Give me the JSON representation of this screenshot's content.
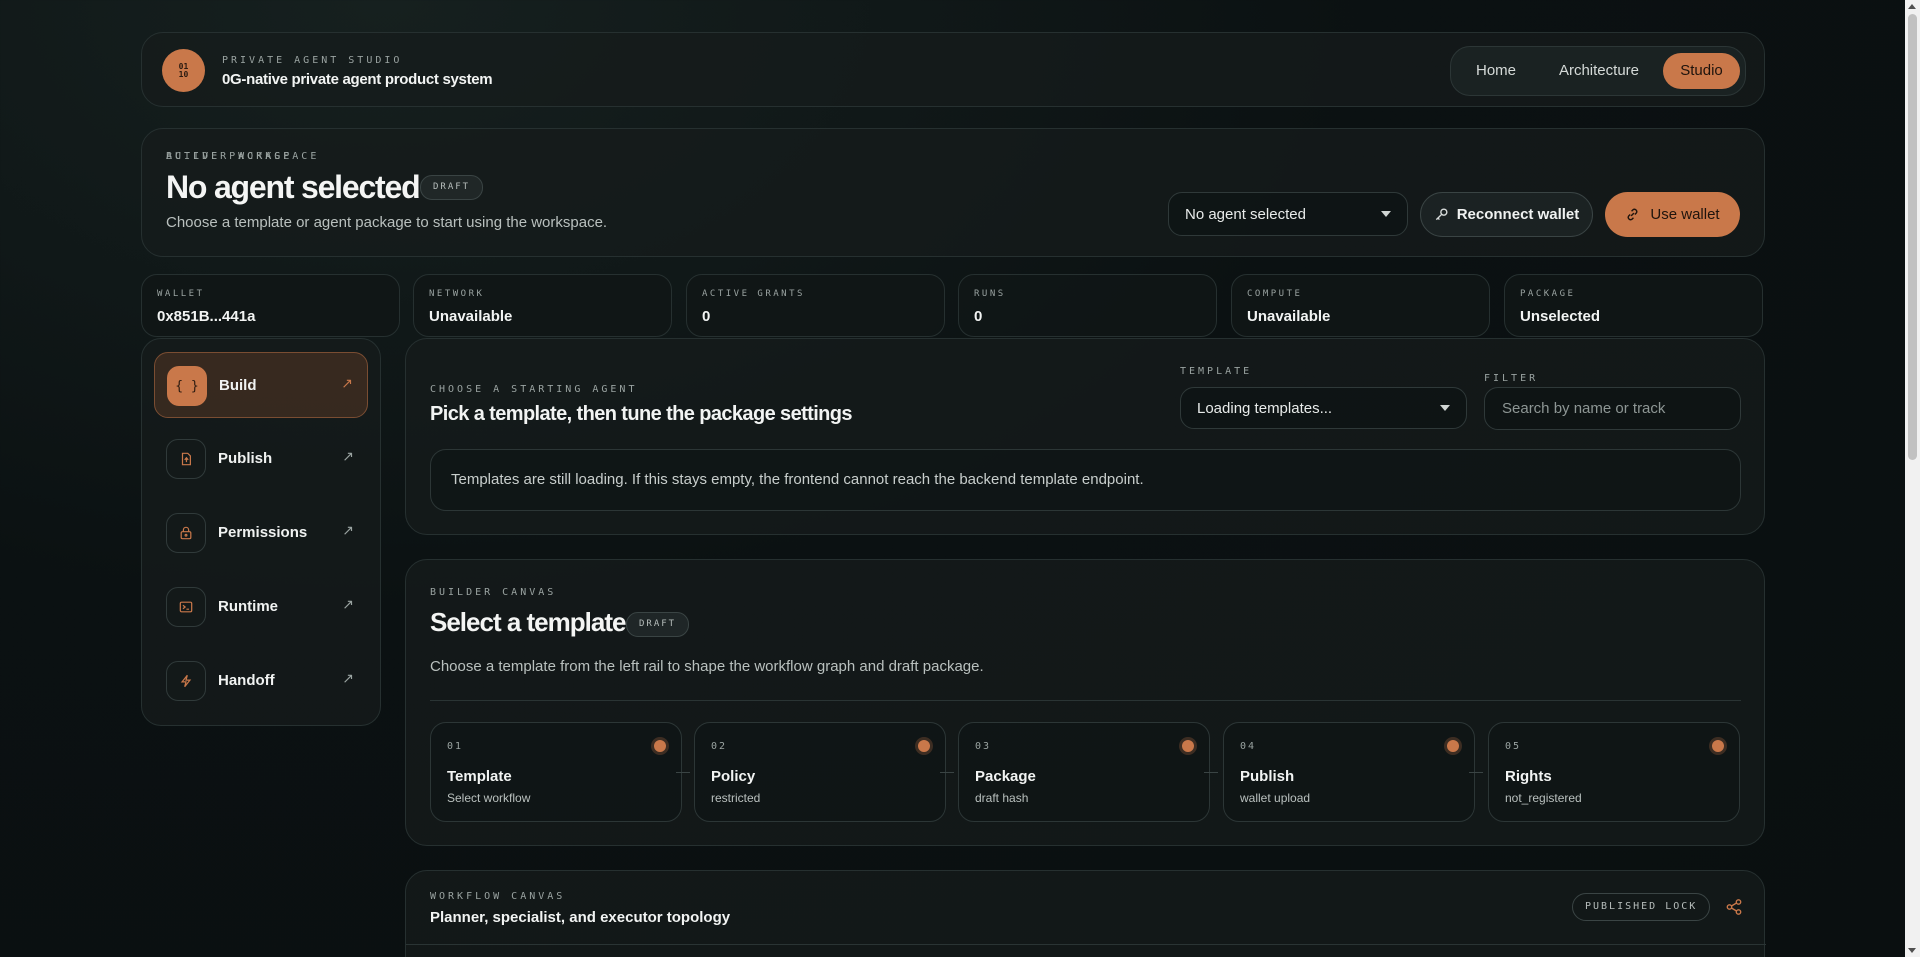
{
  "header": {
    "logo_top": "01",
    "logo_bottom": "10",
    "eyebrow": "PRIVATE AGENT STUDIO",
    "title": "0G-native private agent product system",
    "nav": [
      {
        "label": "Home",
        "active": false
      },
      {
        "label": "Architecture",
        "active": false
      },
      {
        "label": "Studio",
        "active": true
      }
    ]
  },
  "workspace": {
    "eyebrow": "BUILDER WORKSPACE",
    "title": "No agent selected",
    "badge": "DRAFT",
    "subtitle": "Choose a template or agent package to start using the workspace.",
    "active_package_label": "ACTIVE PACKAGE",
    "active_package_value": "No agent selected",
    "reconnect_label": "Reconnect wallet",
    "use_wallet_label": "Use wallet"
  },
  "stats": [
    {
      "label": "WALLET",
      "value": "0x851B...441a"
    },
    {
      "label": "NETWORK",
      "value": "Unavailable"
    },
    {
      "label": "ACTIVE GRANTS",
      "value": "0"
    },
    {
      "label": "RUNS",
      "value": "0"
    },
    {
      "label": "COMPUTE",
      "value": "Unavailable"
    },
    {
      "label": "PACKAGE",
      "value": "Unselected"
    }
  ],
  "sidebar": {
    "items": [
      {
        "label": "Build",
        "icon": "braces-icon",
        "active": true
      },
      {
        "label": "Publish",
        "icon": "file-icon",
        "active": false
      },
      {
        "label": "Permissions",
        "icon": "lock-icon",
        "active": false
      },
      {
        "label": "Runtime",
        "icon": "terminal-icon",
        "active": false
      },
      {
        "label": "Handoff",
        "icon": "bolt-icon",
        "active": false
      }
    ]
  },
  "choose": {
    "eyebrow": "CHOOSE A STARTING AGENT",
    "title": "Pick a template, then tune the package settings",
    "template_label": "TEMPLATE",
    "template_value": "Loading templates...",
    "filter_label": "FILTER",
    "filter_placeholder": "Search by name or track",
    "filter_value": "",
    "notice": "Templates are still loading. If this stays empty, the frontend cannot reach the backend template endpoint."
  },
  "builder": {
    "eyebrow": "BUILDER CANVAS",
    "title": "Select a template",
    "badge": "DRAFT",
    "subtitle": "Choose a template from the left rail to shape the workflow graph and draft package.",
    "steps": [
      {
        "num": "01",
        "title": "Template",
        "sub": "Select workflow"
      },
      {
        "num": "02",
        "title": "Policy",
        "sub": "restricted"
      },
      {
        "num": "03",
        "title": "Package",
        "sub": "draft hash"
      },
      {
        "num": "04",
        "title": "Publish",
        "sub": "wallet upload"
      },
      {
        "num": "05",
        "title": "Rights",
        "sub": "not_registered"
      }
    ]
  },
  "workflow": {
    "eyebrow": "WORKFLOW CANVAS",
    "title": "Planner, specialist, and executor topology",
    "lock_badge": "PUBLISHED LOCK"
  },
  "colors": {
    "accent": "#c9784a",
    "background": "#0b1112"
  }
}
